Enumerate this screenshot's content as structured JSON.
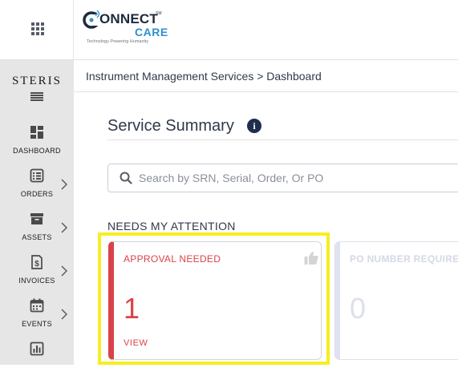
{
  "header": {
    "apps_menu_icon": "apps-grid-icon",
    "logo": {
      "connect": "ONNECT",
      "sm": "SM",
      "care": "CARE",
      "tagline": "Technology Powering Humanity"
    }
  },
  "sidebar": {
    "brand": "STERIS",
    "items": [
      {
        "label": "DASHBOARD",
        "icon": "dashboard-icon",
        "has_submenu": false
      },
      {
        "label": "ORDERS",
        "icon": "orders-icon",
        "has_submenu": true
      },
      {
        "label": "ASSETS",
        "icon": "assets-icon",
        "has_submenu": true
      },
      {
        "label": "INVOICES",
        "icon": "invoices-icon",
        "has_submenu": true
      },
      {
        "label": "EVENTS",
        "icon": "events-icon",
        "has_submenu": true
      },
      {
        "label": "",
        "icon": "reports-icon",
        "has_submenu": false
      }
    ]
  },
  "breadcrumb": {
    "text": "Instrument Management Services > Dashboard"
  },
  "main": {
    "title": "Service Summary",
    "search_placeholder": "Search by SRN, Serial, Order, Or PO",
    "section_heading": "NEEDS MY ATTENTION",
    "cards": [
      {
        "title": "APPROVAL NEEDED",
        "count": "1",
        "link": "VIEW",
        "icon": "thumbs-up-icon"
      },
      {
        "title": "PO NUMBER REQUIRED",
        "count": "0"
      }
    ]
  },
  "colors": {
    "accent_red": "#d9434a",
    "highlight": "#f6ee22",
    "sidebar_bg": "#e6e6e6",
    "title_text": "#2f3a4a"
  }
}
